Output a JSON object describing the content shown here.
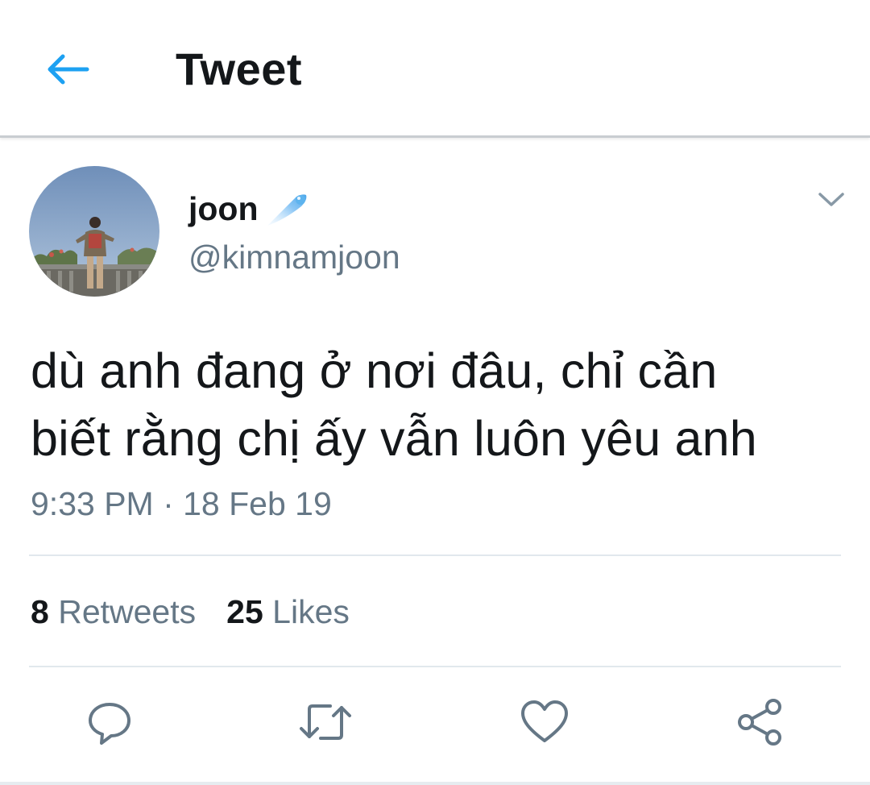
{
  "header": {
    "title": "Tweet",
    "back_icon": "arrow-left-icon"
  },
  "tweet": {
    "author": {
      "name": "joon",
      "handle": "@kimnamjoon",
      "badge_icon": "comet-icon"
    },
    "text_lines": [
      "dù anh đang ở nơi đâu, chỉ cần",
      "biết rằng chị ấy vẫn luôn yêu anh"
    ],
    "timestamp": "9:33 PM · 18 Feb 19",
    "stats": {
      "retweets_count": "8",
      "retweets_label": "Retweets",
      "likes_count": "25",
      "likes_label": "Likes"
    }
  },
  "actions": [
    {
      "name": "reply",
      "icon": "reply-icon"
    },
    {
      "name": "retweet",
      "icon": "retweet-icon"
    },
    {
      "name": "like",
      "icon": "heart-icon"
    },
    {
      "name": "share",
      "icon": "share-icon"
    }
  ],
  "colors": {
    "accent": "#1da1f2",
    "text_primary": "#14171a",
    "text_secondary": "#657786",
    "divider": "#e1e8ed",
    "icon_gray": "#657786"
  }
}
